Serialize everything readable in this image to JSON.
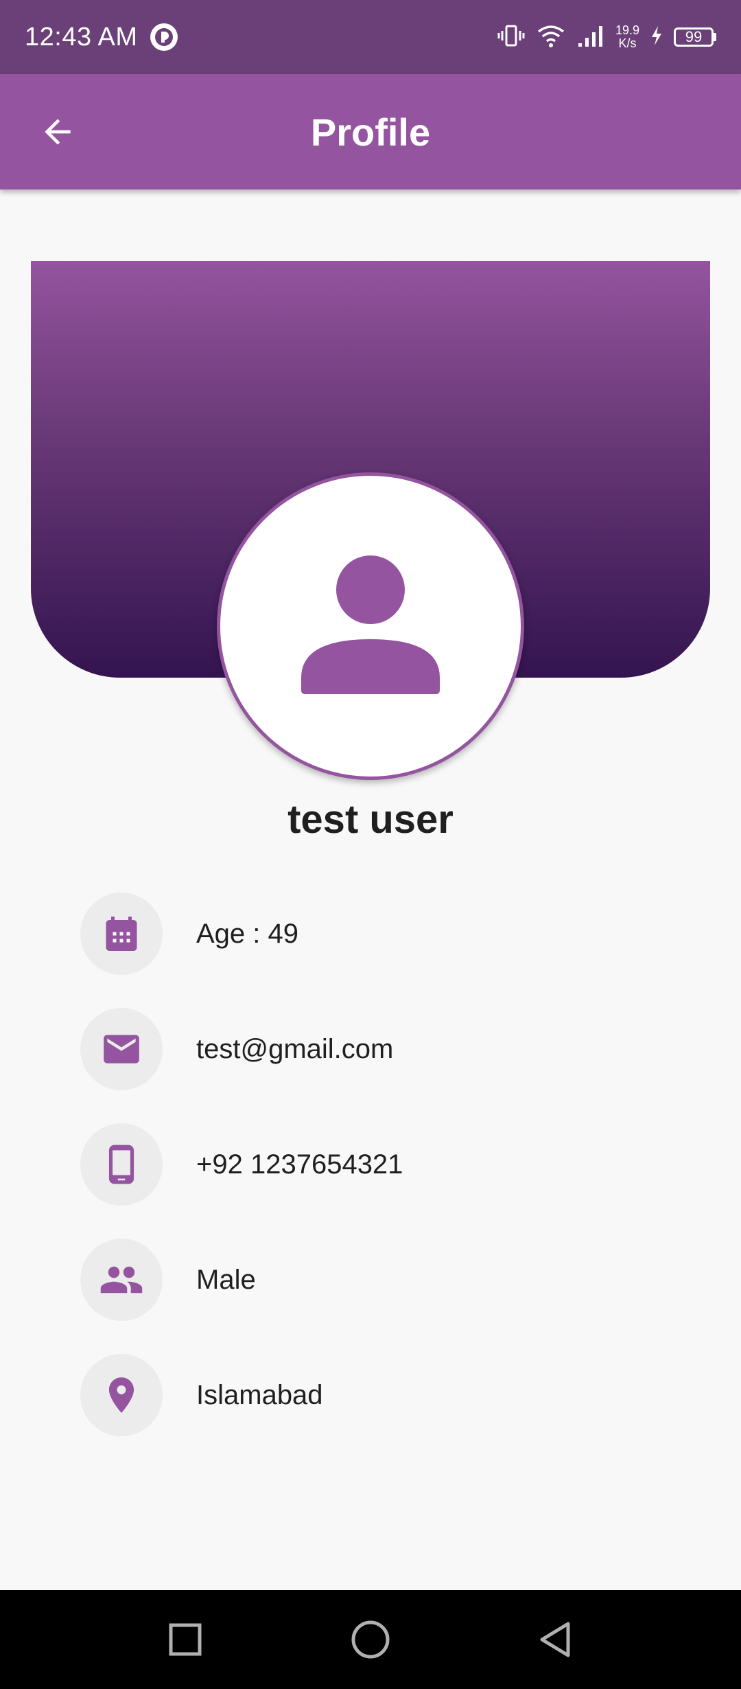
{
  "status_bar": {
    "time": "12:43 AM",
    "net_speed_value": "19.9",
    "net_speed_unit": "K/s",
    "battery": "99"
  },
  "app_bar": {
    "title": "Profile"
  },
  "profile": {
    "name": "test user",
    "items": [
      {
        "icon": "calendar-icon",
        "text": "Age : 49"
      },
      {
        "icon": "email-icon",
        "text": "test@gmail.com"
      },
      {
        "icon": "phone-icon",
        "text": "+92 1237654321"
      },
      {
        "icon": "people-icon",
        "text": "Male"
      },
      {
        "icon": "location-pin-icon",
        "text": "Islamabad"
      }
    ]
  },
  "colors": {
    "primary": "#94549f",
    "status_bar": "#6b3f77",
    "header_gradient_start": "#94549f",
    "header_gradient_end": "#341450",
    "icon_circle_bg": "#ececec",
    "background": "#f8f8f8"
  }
}
